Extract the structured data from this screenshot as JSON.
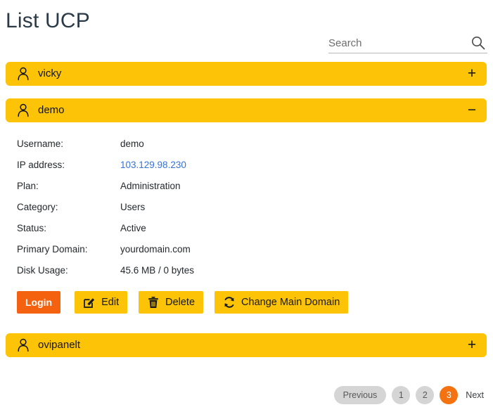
{
  "page": {
    "title": "List UCP"
  },
  "search": {
    "placeholder": "Search",
    "value": "",
    "icon": "search-icon"
  },
  "accounts": [
    {
      "name": "vicky",
      "expanded": false,
      "toggle": "+",
      "icon": "person-icon"
    },
    {
      "name": "demo",
      "expanded": true,
      "toggle": "−",
      "icon": "person-icon"
    },
    {
      "name": "ovipanelt",
      "expanded": false,
      "toggle": "+",
      "icon": "person-icon"
    }
  ],
  "details": {
    "rows": [
      {
        "label": "Username:",
        "value": "demo",
        "link": false
      },
      {
        "label": "IP address:",
        "value": "103.129.98.230",
        "link": true
      },
      {
        "label": "Plan:",
        "value": "Administration",
        "link": false
      },
      {
        "label": "Category:",
        "value": "Users",
        "link": false
      },
      {
        "label": "Status:",
        "value": "Active",
        "link": false
      },
      {
        "label": "Primary Domain:",
        "value": "yourdomain.com",
        "link": false
      },
      {
        "label": "Disk Usage:",
        "value": "45.6 MB / 0 bytes",
        "link": false
      }
    ]
  },
  "actions": [
    {
      "label": "Login",
      "icon": "",
      "style": "orange"
    },
    {
      "label": "Edit",
      "icon": "pencil-square-icon",
      "style": "amber"
    },
    {
      "label": "Delete",
      "icon": "trash-icon",
      "style": "amber"
    },
    {
      "label": "Change Main Domain",
      "icon": "refresh-icon",
      "style": "amber"
    }
  ],
  "pagination": {
    "previous_label": "Previous",
    "next_label": "Next",
    "pages": [
      "1",
      "2",
      "3"
    ],
    "active_page": "3"
  },
  "colors": {
    "amber": "#fdc307",
    "orange": "#f4620f",
    "active_page": "#f4720f",
    "link": "#3273dc",
    "title": "#2a3a47",
    "pager_idle": "#d5d5d5"
  }
}
